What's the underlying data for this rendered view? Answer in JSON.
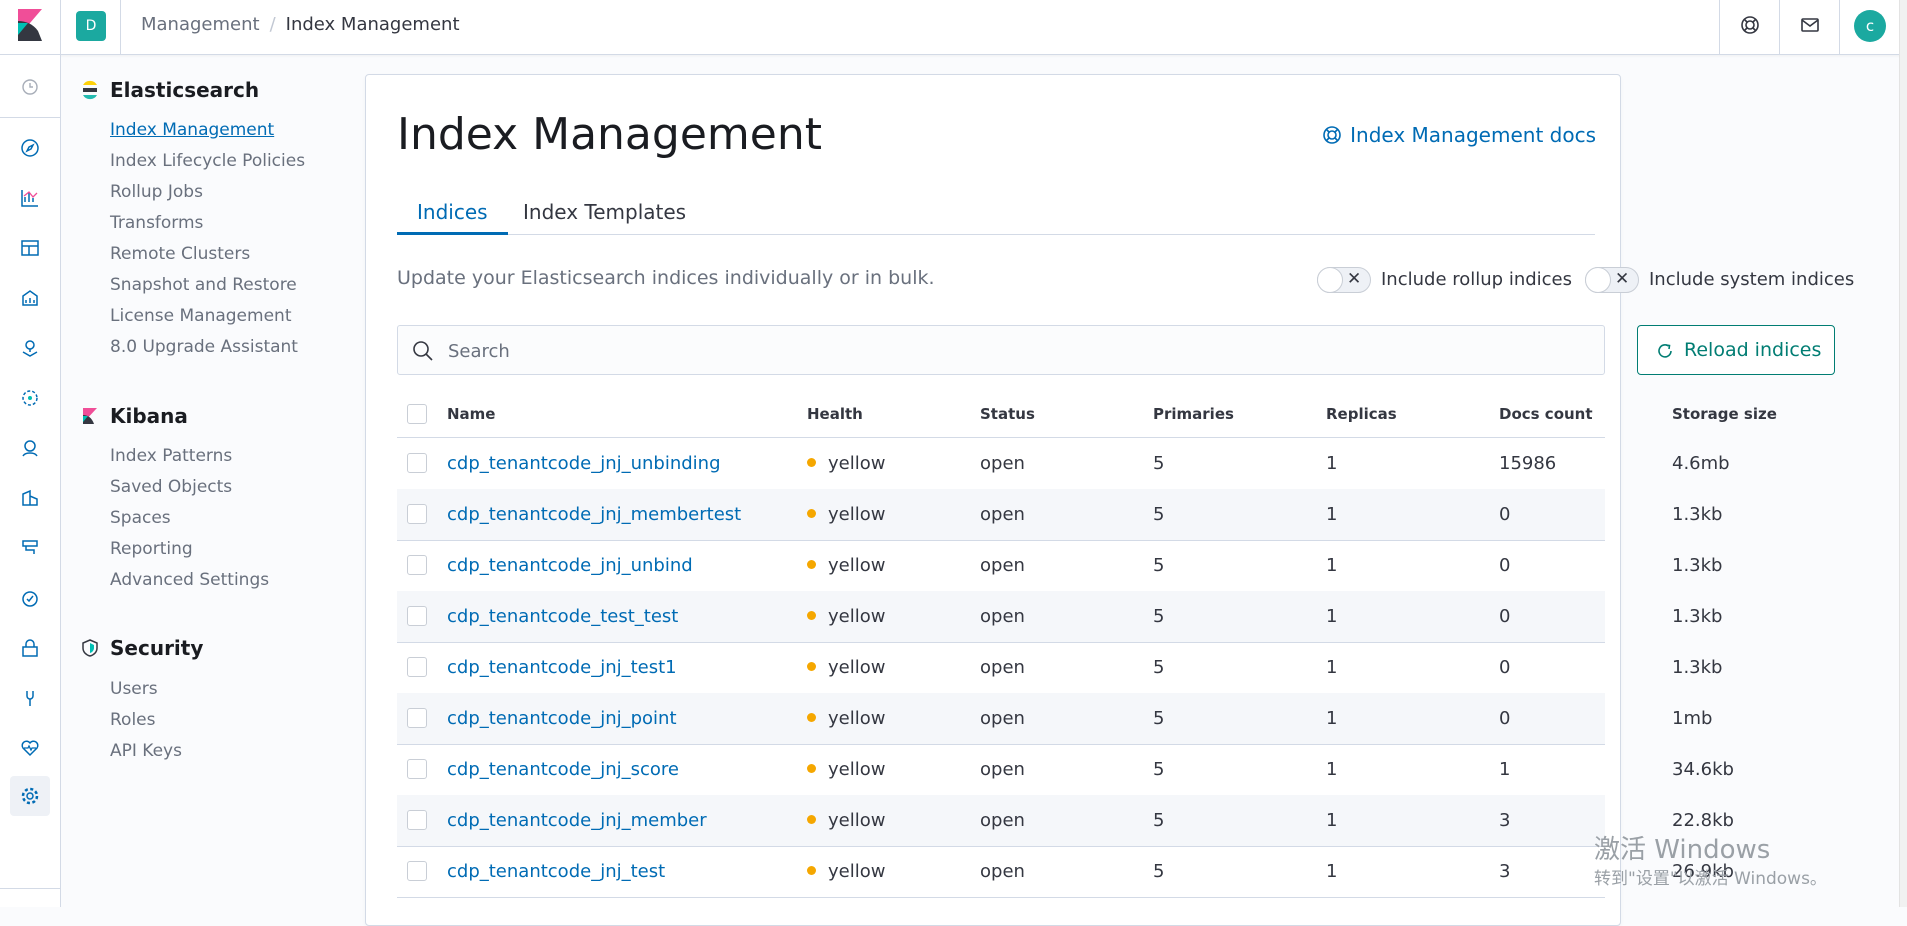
{
  "header": {
    "space_initial": "D",
    "breadcrumbs": [
      "Management",
      "Index Management"
    ],
    "user_initial": "c",
    "icons": [
      "help-icon",
      "newsfeed-icon"
    ]
  },
  "sidenav": {
    "groups": [
      {
        "title": "Elasticsearch",
        "icon": "elasticsearch-logo-icon",
        "items": [
          "Index Management",
          "Index Lifecycle Policies",
          "Rollup Jobs",
          "Transforms",
          "Remote Clusters",
          "Snapshot and Restore",
          "License Management",
          "8.0 Upgrade Assistant"
        ]
      },
      {
        "title": "Kibana",
        "icon": "kibana-logo-icon",
        "items": [
          "Index Patterns",
          "Saved Objects",
          "Spaces",
          "Reporting",
          "Advanced Settings"
        ]
      },
      {
        "title": "Security",
        "icon": "security-shield-icon",
        "items": [
          "Users",
          "Roles",
          "API Keys"
        ]
      }
    ],
    "selected": "Index Management"
  },
  "main": {
    "title": "Index Management",
    "docs_link": "Index Management docs",
    "tabs": [
      "Indices",
      "Index Templates"
    ],
    "active_tab": "Indices",
    "description": "Update your Elasticsearch indices individually or in bulk.",
    "switch_rollup": "Include rollup indices",
    "switch_system": "Include system indices",
    "search_placeholder": "Search",
    "reload_label": "Reload indices"
  },
  "table": {
    "columns": [
      "Name",
      "Health",
      "Status",
      "Primaries",
      "Replicas",
      "Docs count",
      "Storage size"
    ],
    "rows": [
      {
        "name": "cdp_tenantcode_jnj_unbinding",
        "health": "yellow",
        "status": "open",
        "primaries": "5",
        "replicas": "1",
        "docs": "15986",
        "size": "4.6mb"
      },
      {
        "name": "cdp_tenantcode_jnj_membertest",
        "health": "yellow",
        "status": "open",
        "primaries": "5",
        "replicas": "1",
        "docs": "0",
        "size": "1.3kb"
      },
      {
        "name": "cdp_tenantcode_jnj_unbind",
        "health": "yellow",
        "status": "open",
        "primaries": "5",
        "replicas": "1",
        "docs": "0",
        "size": "1.3kb"
      },
      {
        "name": "cdp_tenantcode_test_test",
        "health": "yellow",
        "status": "open",
        "primaries": "5",
        "replicas": "1",
        "docs": "0",
        "size": "1.3kb"
      },
      {
        "name": "cdp_tenantcode_jnj_test1",
        "health": "yellow",
        "status": "open",
        "primaries": "5",
        "replicas": "1",
        "docs": "0",
        "size": "1.3kb"
      },
      {
        "name": "cdp_tenantcode_jnj_point",
        "health": "yellow",
        "status": "open",
        "primaries": "5",
        "replicas": "1",
        "docs": "0",
        "size": "1mb"
      },
      {
        "name": "cdp_tenantcode_jnj_score",
        "health": "yellow",
        "status": "open",
        "primaries": "5",
        "replicas": "1",
        "docs": "1",
        "size": "34.6kb"
      },
      {
        "name": "cdp_tenantcode_jnj_member",
        "health": "yellow",
        "status": "open",
        "primaries": "5",
        "replicas": "1",
        "docs": "3",
        "size": "22.8kb"
      },
      {
        "name": "cdp_tenantcode_jnj_test",
        "health": "yellow",
        "status": "open",
        "primaries": "5",
        "replicas": "1",
        "docs": "3",
        "size": "26.9kb"
      }
    ]
  },
  "colors": {
    "accent": "#006bb4",
    "health_yellow": "#f5a700",
    "primary_green": "#017d73"
  },
  "watermark": {
    "line1": "激活 Windows",
    "line2": "转到\"设置\"以激活 Windows。"
  }
}
